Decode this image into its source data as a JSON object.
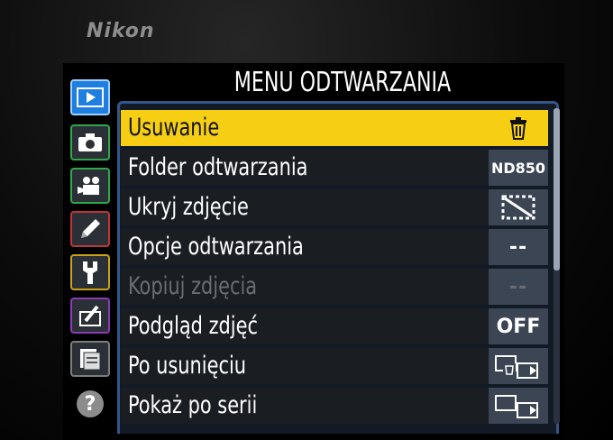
{
  "brand": "Nikon",
  "menu": {
    "title": "MENU ODTWARZANIA"
  },
  "sidebar": {
    "tabs": [
      {
        "icon": "playback-icon",
        "active": true
      },
      {
        "icon": "camera-icon"
      },
      {
        "icon": "movie-camera-icon"
      },
      {
        "icon": "pencil-icon"
      },
      {
        "icon": "wrench-icon"
      },
      {
        "icon": "retouch-icon"
      },
      {
        "icon": "my-menu-icon"
      },
      {
        "icon": "help-icon",
        "glyph": "?"
      }
    ]
  },
  "items": [
    {
      "label": "Usuwanie",
      "value_icon": "trash-icon",
      "selected": true
    },
    {
      "label": "Folder odtwarzania",
      "value": "ND850"
    },
    {
      "label": "Ukryj zdjęcie",
      "value_icon": "hidden-frame-icon"
    },
    {
      "label": "Opcje odtwarzania",
      "value": "--"
    },
    {
      "label": "Kopiuj zdjęcia",
      "value": "--",
      "disabled": true
    },
    {
      "label": "Podgląd zdjęć",
      "value": "OFF"
    },
    {
      "label": "Po usunięciu",
      "value_icon": "after-delete-icon"
    },
    {
      "label": "Pokaż po serii",
      "value_icon": "after-burst-icon"
    }
  ],
  "colors": {
    "highlight": "#f6cf14",
    "panel_border": "#33578a",
    "value_bg": "#3b4554"
  }
}
